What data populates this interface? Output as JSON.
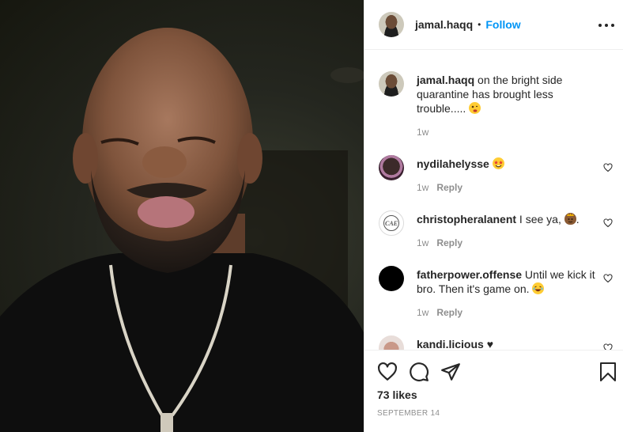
{
  "post": {
    "username": "jamal.haqq",
    "follow_label": "Follow",
    "separator": "•",
    "caption": "on the bright side quarantine has brought less trouble.....",
    "caption_time": "1w",
    "likes": "73 likes",
    "date": "SEPTEMBER 14"
  },
  "comments": [
    {
      "username": "nydilahelysse",
      "text": "",
      "emoji": "star-struck-emoji",
      "time": "1w",
      "reply": "Reply"
    },
    {
      "username": "christopheralanent",
      "text": "I see ya,",
      "emoji": "crown-face-emoji",
      "suffix": ".",
      "time": "1w",
      "reply": "Reply",
      "avatar_text": "CAE"
    },
    {
      "username": "fatherpower.offense",
      "text": "Until we kick it bro. Then it's game on.",
      "emoji": "laughing-emoji",
      "time": "1w",
      "reply": "Reply"
    },
    {
      "username": "kandi.licious",
      "text": "♥"
    }
  ],
  "icons": {
    "heart": "heart-icon",
    "comment": "comment-icon",
    "share": "share-icon",
    "save": "bookmark-icon",
    "more": "more-options-icon"
  },
  "colors": {
    "link": "#0095f6",
    "muted": "#8e8e8e",
    "text": "#262626"
  }
}
